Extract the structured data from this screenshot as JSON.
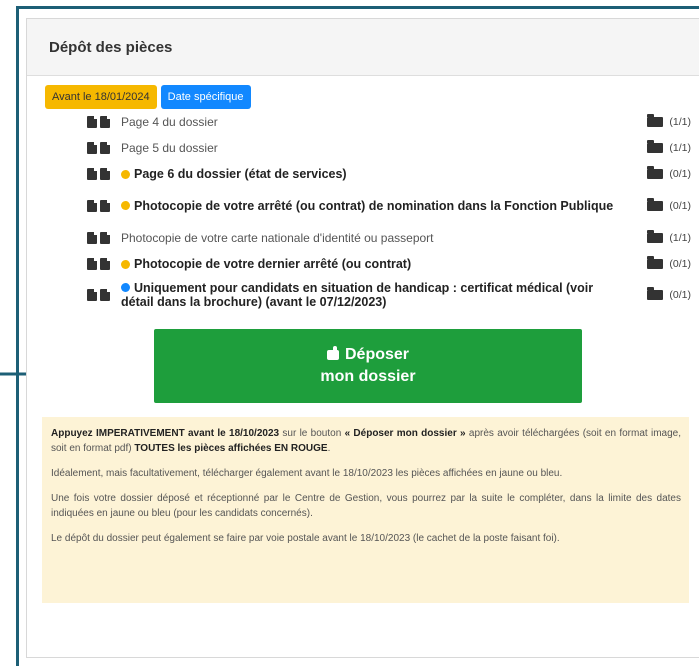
{
  "panel": {
    "title": "Dépôt des pièces"
  },
  "badges": [
    {
      "label": "Avant le 18/01/2024",
      "color": "#f6b800"
    },
    {
      "label": "Date spécifique",
      "color": "#1288ff"
    }
  ],
  "documents": [
    {
      "label": "Page 4 du dossier",
      "count": "(1/1)",
      "bold": false,
      "dot": null
    },
    {
      "label": "Page 5 du dossier",
      "count": "(1/1)",
      "bold": false,
      "dot": null
    },
    {
      "label": "Page 6 du dossier (état de services)",
      "count": "(0/1)",
      "bold": true,
      "dot": "yellow"
    },
    {
      "label": "Photocopie de votre arrêté (ou contrat) de nomination dans la Fonction Publique",
      "count": "(0/1)",
      "bold": true,
      "dot": "yellow"
    },
    {
      "label": "Photocopie de votre carte nationale d'identité ou passeport",
      "count": "(1/1)",
      "bold": false,
      "dot": null
    },
    {
      "label": "Photocopie de votre dernier arrêté (ou contrat)",
      "count": "(0/1)",
      "bold": true,
      "dot": "yellow"
    },
    {
      "label": "Uniquement pour candidats en situation de handicap : certificat médical (voir détail dans la brochure) (avant le 07/12/2023)",
      "count": "(0/1)",
      "bold": true,
      "dot": "blue"
    }
  ],
  "submit": {
    "line1": "Déposer",
    "line2": "mon dossier",
    "color": "#1e9e3c"
  },
  "info": {
    "p1_a": "Appuyez IMPERATIVEMENT avant le 18/10/2023",
    "p1_b": " sur le bouton ",
    "p1_c": "« Déposer mon dossier »",
    "p1_d": " après avoir téléchargées (soit en format image, soit en format pdf) ",
    "p1_e": "TOUTES les pièces affichées EN ROUGE",
    "p1_f": ".",
    "p2": "Idéalement, mais facultativement, télécharger également avant le 18/10/2023 les pièces affichées en jaune ou bleu.",
    "p3": "Une fois votre dossier déposé et réceptionné par le Centre de Gestion, vous pourrez par la suite le compléter, dans la limite des dates indiquées en jaune ou bleu (pour les candidats concernés).",
    "p4": "Le dépôt du dossier peut également se faire par voie postale avant le 18/10/2023 (le cachet de la poste faisant foi).",
    "background": "#fdf3d6"
  },
  "accent": "#1d5f76"
}
